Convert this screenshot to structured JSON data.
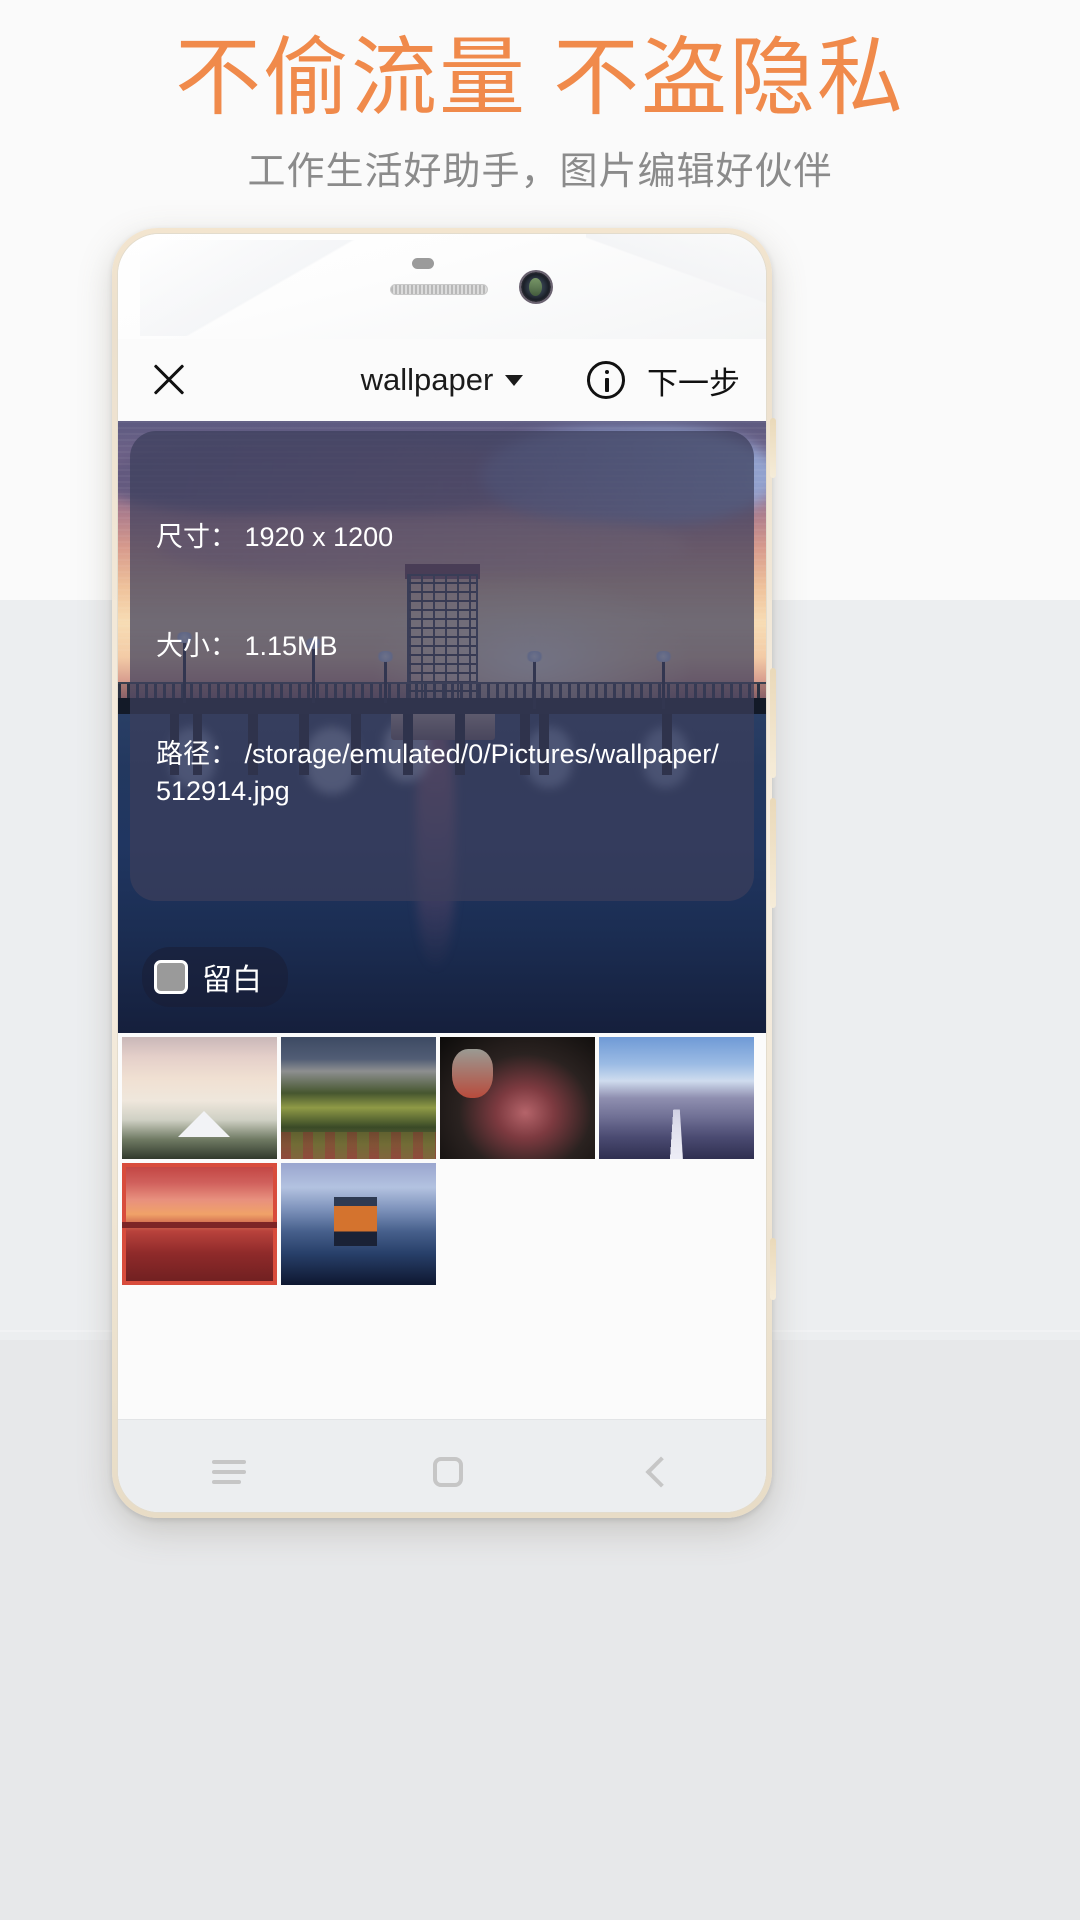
{
  "promo": {
    "headline": "不偷流量 不盗隐私",
    "subhead": "工作生活好助手，图片编辑好伙伴",
    "headline_color": "#f08a4b",
    "subhead_color": "#8b8b8b"
  },
  "appbar": {
    "close_icon": "close-icon",
    "title": "wallpaper",
    "caret_icon": "chevron-down-icon",
    "info_icon": "info-icon",
    "next_label": "下一步"
  },
  "preview": {
    "metadata": {
      "dimension_label": "尺寸：",
      "dimension_value": "1920 x 1200",
      "size_label": "大小：",
      "size_value": "1.15MB",
      "path_label": "路径：",
      "path_value": "/storage/emulated/0/Pictures/wallpaper/512914.jpg",
      "line1": "尺寸： 1920 x 1200",
      "line2": "大小： 1.15MB",
      "line3": "路径： /storage/emulated/0/Pictures/wallpaper/512914.jpg"
    },
    "whitespace_toggle": {
      "label": "留白",
      "checked": false
    }
  },
  "thumbnails": {
    "rows": [
      [
        {
          "name": "thumb-mountain-lake",
          "art": "t-mountain",
          "selected": false
        },
        {
          "name": "thumb-forest-valley",
          "art": "t-forest",
          "selected": false
        },
        {
          "name": "thumb-steak-food",
          "art": "t-steak",
          "selected": false
        },
        {
          "name": "thumb-lavender-road",
          "art": "t-road",
          "selected": false
        }
      ],
      [
        {
          "name": "thumb-red-pier",
          "art": "t-redpier",
          "selected": true
        },
        {
          "name": "thumb-boathouse",
          "art": "t-boathouse",
          "selected": false
        }
      ]
    ]
  },
  "navbar": {
    "menu_icon": "menu-icon",
    "home_icon": "home-icon",
    "back_icon": "back-icon"
  },
  "hardware": {
    "sensor": "proximity-sensor",
    "speaker": "earpiece-speaker",
    "camera": "front-camera"
  }
}
